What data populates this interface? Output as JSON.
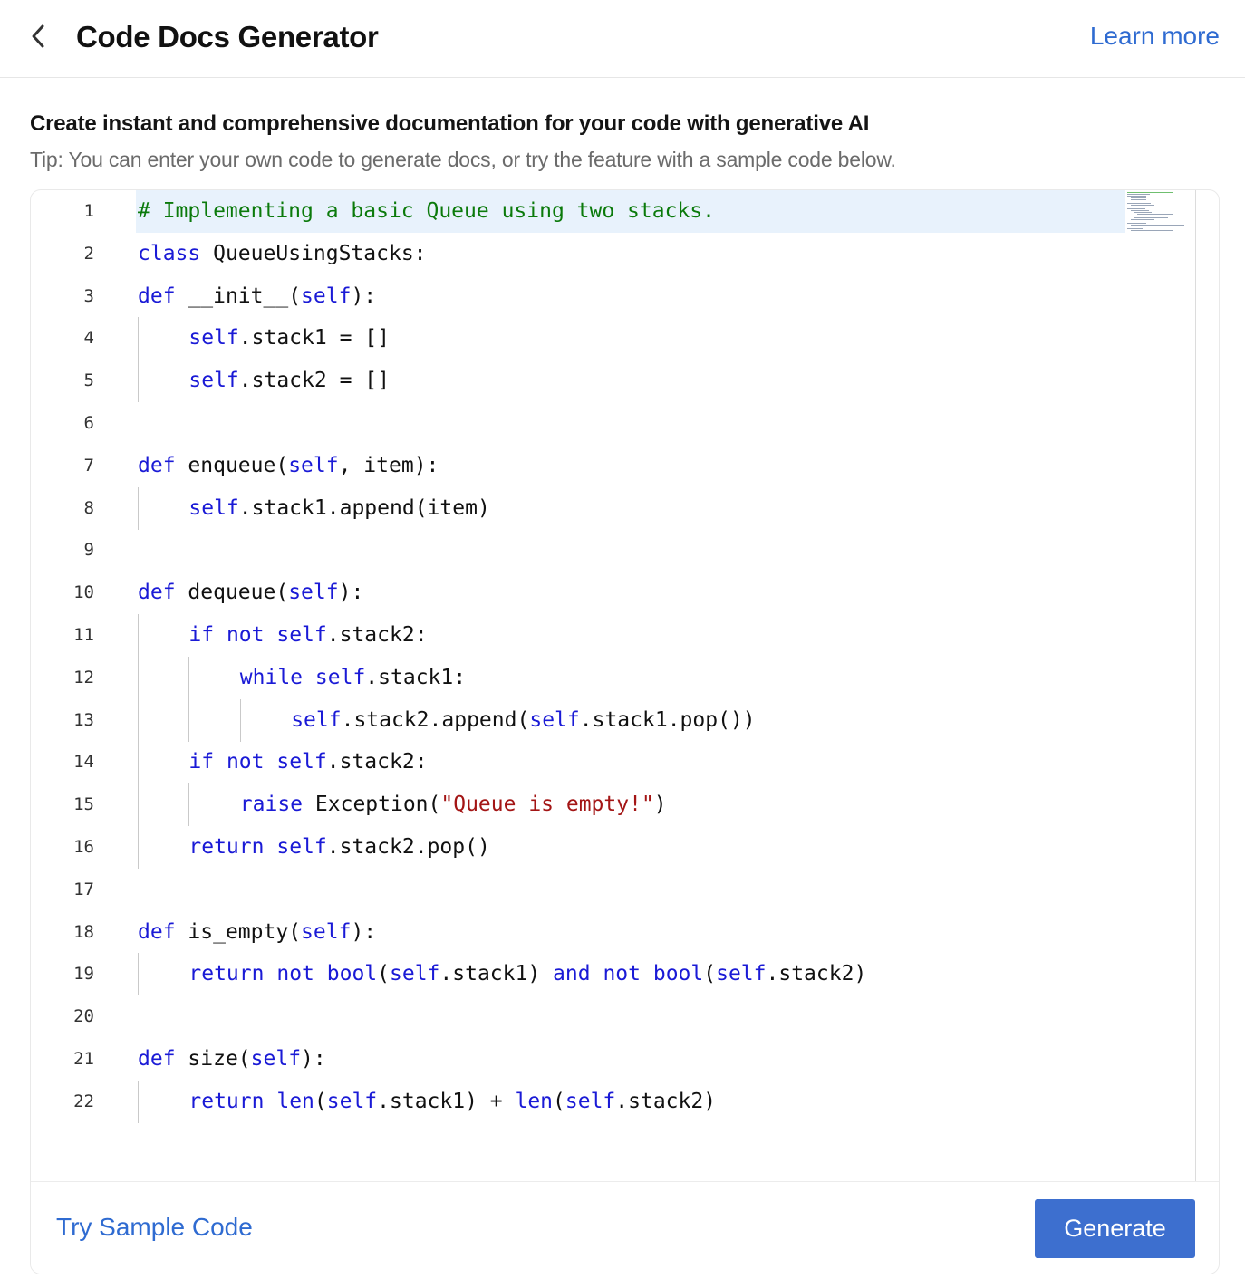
{
  "header": {
    "title": "Code Docs Generator",
    "learn_more": "Learn more"
  },
  "intro": {
    "heading": "Create instant and comprehensive documentation for your code with generative AI",
    "tip": "Tip: You can enter your own code to generate docs, or try the feature with a sample code below."
  },
  "editor": {
    "language": "python",
    "line_numbers": [
      "1",
      "2",
      "3",
      "4",
      "5",
      "6",
      "7",
      "8",
      "9",
      "10",
      "11",
      "12",
      "13",
      "14",
      "15",
      "16",
      "17",
      "18",
      "19",
      "20",
      "21",
      "22"
    ],
    "lines": [
      "# Implementing a basic Queue using two stacks.",
      "class QueueUsingStacks:",
      "def __init__(self):",
      "    self.stack1 = []",
      "    self.stack2 = []",
      "",
      "def enqueue(self, item):",
      "    self.stack1.append(item)",
      "",
      "def dequeue(self):",
      "    if not self.stack2:",
      "        while self.stack1:",
      "            self.stack2.append(self.stack1.pop())",
      "    if not self.stack2:",
      "        raise Exception(\"Queue is empty!\")",
      "    return self.stack2.pop()",
      "",
      "def is_empty(self):",
      "    return not bool(self.stack1) and not bool(self.stack2)",
      "",
      "def size(self):",
      "    return len(self.stack1) + len(self.stack2)"
    ]
  },
  "footer": {
    "try_sample": "Try Sample Code",
    "generate": "Generate"
  },
  "colors": {
    "accent": "#2f6bd1",
    "button": "#3d6fcf",
    "keyword": "#1a1ad6",
    "comment": "#0b7a0b",
    "string": "#a31515",
    "active_line": "#e8f2fc"
  },
  "icons": {
    "back": "chevron-left-icon"
  }
}
